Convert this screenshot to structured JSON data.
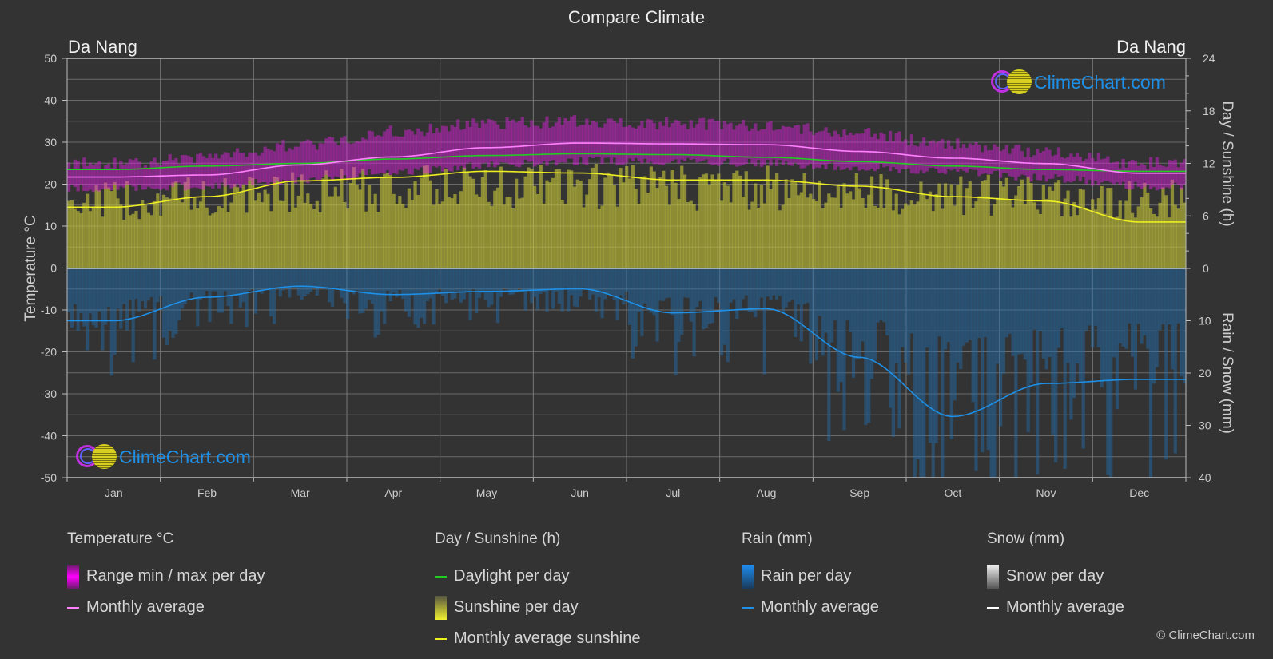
{
  "header": {
    "title": "Compare Climate",
    "location_left": "Da Nang",
    "location_right": "Da Nang"
  },
  "watermark": {
    "text": "ClimeChart.com"
  },
  "copyright": "© ClimeChart.com",
  "colors": {
    "background": "#333333",
    "temperature_range": "#e020e0",
    "temperature_avg": "#ff80ff",
    "daylight": "#22cc22",
    "sunshine_fill": "#c8c83a",
    "sunshine_avg": "#eeee22",
    "rain_fill": "#1f6fb0",
    "rain_avg": "#1e90e8",
    "snow_avg": "#ffffff",
    "grid": "#6a6a6a"
  },
  "legend": {
    "temperature": {
      "heading": "Temperature °C",
      "items": [
        {
          "label": "Range min / max per day",
          "swatch": "box-magenta"
        },
        {
          "label": "Monthly average",
          "swatch": "line-pink"
        }
      ]
    },
    "sunshine": {
      "heading": "Day / Sunshine (h)",
      "items": [
        {
          "label": "Daylight per day",
          "swatch": "line-green"
        },
        {
          "label": "Sunshine per day",
          "swatch": "box-yellow"
        },
        {
          "label": "Monthly average sunshine",
          "swatch": "line-yellow"
        }
      ]
    },
    "rain": {
      "heading": "Rain (mm)",
      "items": [
        {
          "label": "Rain per day",
          "swatch": "box-blue"
        },
        {
          "label": "Monthly average",
          "swatch": "line-blue"
        }
      ]
    },
    "snow": {
      "heading": "Snow (mm)",
      "items": [
        {
          "label": "Snow per day",
          "swatch": "box-white"
        },
        {
          "label": "Monthly average",
          "swatch": "line-white"
        }
      ]
    }
  },
  "chart_data": {
    "type": "line",
    "title": "Compare Climate",
    "categories": [
      "Jan",
      "Feb",
      "Mar",
      "Apr",
      "May",
      "Jun",
      "Jul",
      "Aug",
      "Sep",
      "Oct",
      "Nov",
      "Dec"
    ],
    "axes": {
      "left": {
        "label": "Temperature °C",
        "range": [
          -50,
          50
        ],
        "ticks": [
          50,
          40,
          30,
          20,
          10,
          0,
          -10,
          -20,
          -30,
          -40,
          -50
        ]
      },
      "right_top": {
        "label": "Day / Sunshine (h)",
        "range": [
          0,
          24
        ],
        "ticks": [
          24,
          18,
          12,
          6,
          0
        ]
      },
      "right_bottom": {
        "label": "Rain / Snow (mm)",
        "range": [
          0,
          40
        ],
        "ticks": [
          0,
          10,
          20,
          30,
          40
        ]
      }
    },
    "grid": true,
    "legend_position": "bottom",
    "series": [
      {
        "name": "Temperature monthly average (°C)",
        "axis": "left",
        "values": [
          21.7,
          22.2,
          24.6,
          26.5,
          28.7,
          29.8,
          29.6,
          29.4,
          27.8,
          26.2,
          24.9,
          22.6
        ]
      },
      {
        "name": "Temperature daily max envelope (°C)",
        "axis": "left",
        "values": [
          25.0,
          26.5,
          29.5,
          32.5,
          34.5,
          35.0,
          34.5,
          34.0,
          32.0,
          29.5,
          27.5,
          25.0
        ]
      },
      {
        "name": "Temperature daily min envelope (°C)",
        "axis": "left",
        "values": [
          19.0,
          19.5,
          21.0,
          23.0,
          24.5,
          25.5,
          25.5,
          25.0,
          24.0,
          23.0,
          21.5,
          19.5
        ]
      },
      {
        "name": "Daylight per day (h)",
        "axis": "right_top",
        "values": [
          11.3,
          11.7,
          12.0,
          12.5,
          12.9,
          13.1,
          13.0,
          12.7,
          12.2,
          11.7,
          11.3,
          11.1
        ]
      },
      {
        "name": "Monthly average sunshine (h)",
        "axis": "right_top",
        "values": [
          7.0,
          8.2,
          10.0,
          10.4,
          11.1,
          10.9,
          10.1,
          10.1,
          9.4,
          8.2,
          7.7,
          5.3
        ]
      },
      {
        "name": "Sunshine per day envelope (h)",
        "axis": "right_top",
        "values": [
          10.0,
          10.5,
          11.3,
          11.8,
          12.0,
          12.0,
          12.0,
          11.8,
          11.2,
          10.8,
          10.5,
          10.2
        ]
      },
      {
        "name": "Rain monthly average (mm)",
        "axis": "right_bottom",
        "values": [
          10.0,
          5.5,
          3.4,
          5.0,
          4.4,
          3.9,
          8.5,
          7.7,
          17.0,
          28.3,
          22.0,
          21.2
        ]
      }
    ]
  }
}
